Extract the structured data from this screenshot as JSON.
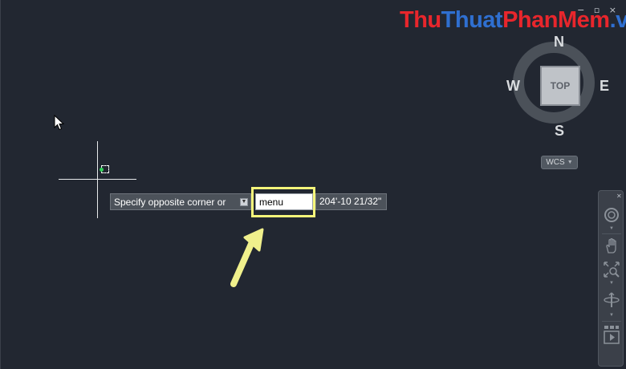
{
  "window": {
    "controls": "− ▫ ×"
  },
  "watermark": {
    "part1": "Thu",
    "part2": "Thuat",
    "part3": "PhanMem",
    "part4": ".vn"
  },
  "viewcube": {
    "face": "TOP",
    "north": "N",
    "south": "S",
    "west": "W",
    "east": "E",
    "coord_system": "WCS"
  },
  "dynamic_input": {
    "prompt": "Specify opposite corner or",
    "value": "menu",
    "coordinate": "204'-10 21/32\""
  },
  "navbar": {
    "tools": [
      "steering-wheel",
      "pan",
      "zoom-extents",
      "orbit",
      "showmotion"
    ]
  },
  "colors": {
    "canvas": "#222731",
    "highlight": "#f5f57a",
    "callout_arrow": "#f0f08c",
    "snap_marker": "#33d15a"
  }
}
